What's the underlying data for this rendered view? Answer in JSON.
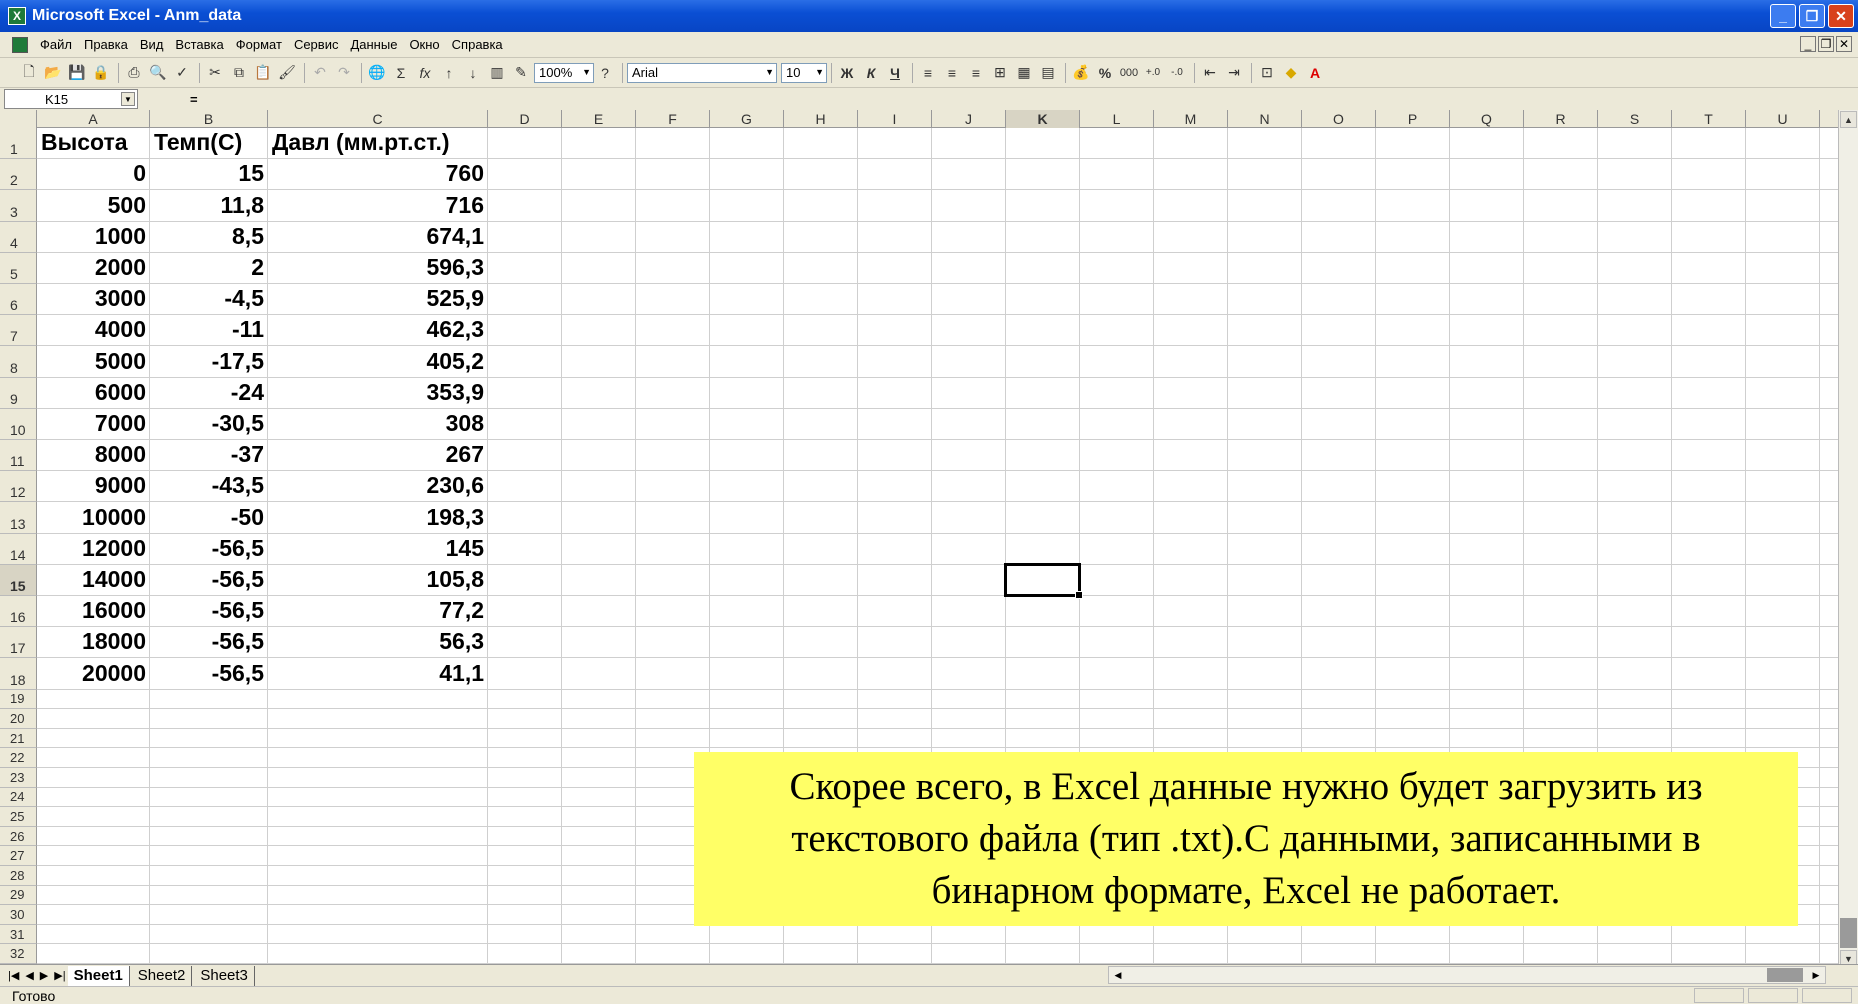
{
  "window": {
    "title": "Microsoft Excel - Anm_data"
  },
  "menu": [
    "Файл",
    "Правка",
    "Вид",
    "Вставка",
    "Формат",
    "Сервис",
    "Данные",
    "Окно",
    "Справка"
  ],
  "toolbar": {
    "zoom": "100%",
    "font": "Arial",
    "font_size": "10",
    "bold": "Ж",
    "italic": "К",
    "underline": "Ч",
    "percent": "%",
    "thousands": "000"
  },
  "formula_bar": {
    "name_box": "K15",
    "fx": "="
  },
  "columns": [
    "A",
    "B",
    "C",
    "D",
    "E",
    "F",
    "G",
    "H",
    "I",
    "J",
    "K",
    "L",
    "M",
    "N",
    "O",
    "P",
    "Q",
    "R",
    "S",
    "T",
    "U"
  ],
  "active_column": "K",
  "active_row": 15,
  "rows": [
    1,
    2,
    3,
    4,
    5,
    6,
    7,
    8,
    9,
    10,
    11,
    12,
    13,
    14,
    15,
    16,
    17,
    18,
    19,
    20,
    21,
    22,
    23,
    24,
    25,
    26,
    27,
    28,
    29,
    30,
    31,
    32
  ],
  "table": {
    "headers": [
      "Высота",
      "Темп(С)",
      "Давл (мм.рт.ст.)"
    ],
    "data": [
      [
        "0",
        "15",
        "760"
      ],
      [
        "500",
        "11,8",
        "716"
      ],
      [
        "1000",
        "8,5",
        "674,1"
      ],
      [
        "2000",
        "2",
        "596,3"
      ],
      [
        "3000",
        "-4,5",
        "525,9"
      ],
      [
        "4000",
        "-11",
        "462,3"
      ],
      [
        "5000",
        "-17,5",
        "405,2"
      ],
      [
        "6000",
        "-24",
        "353,9"
      ],
      [
        "7000",
        "-30,5",
        "308"
      ],
      [
        "8000",
        "-37",
        "267"
      ],
      [
        "9000",
        "-43,5",
        "230,6"
      ],
      [
        "10000",
        "-50",
        "198,3"
      ],
      [
        "12000",
        "-56,5",
        "145"
      ],
      [
        "14000",
        "-56,5",
        "105,8"
      ],
      [
        "16000",
        "-56,5",
        "77,2"
      ],
      [
        "18000",
        "-56,5",
        "56,3"
      ],
      [
        "20000",
        "-56,5",
        "41,1"
      ]
    ]
  },
  "note": {
    "text": "Скорее всего, в Excel данные нужно будет загрузить из текстового файла (тип .txt).С данными, записанными в бинарном формате, Excel не работает.",
    "color": "#ffff66"
  },
  "sheets": [
    "Sheet1",
    "Sheet2",
    "Sheet3"
  ],
  "active_sheet": "Sheet1",
  "status": "Готово"
}
